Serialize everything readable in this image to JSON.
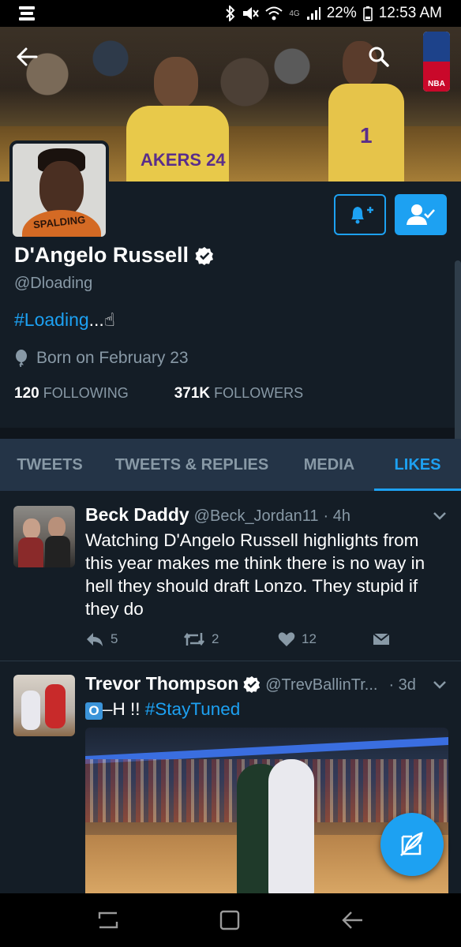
{
  "status_bar": {
    "battery_percent": "22%",
    "time": "12:53 AM",
    "network": "4G",
    "icons": [
      "espn-app-icon",
      "bluetooth-icon",
      "mute-icon",
      "wifi-icon",
      "signal-icon",
      "battery-icon"
    ]
  },
  "header": {
    "back_icon": "back-arrow-icon",
    "search_icon": "search-icon",
    "banner_jersey_left": "AKERS 24",
    "banner_jersey_right": "1",
    "nba_logo_text": "NBA"
  },
  "profile": {
    "avatar_ball_text": "SPALDING",
    "name": "D'Angelo Russell",
    "verified": true,
    "handle": "@Dloading",
    "bio_hashtag": "#Loading",
    "bio_suffix": "...☝",
    "birthday": "Born on February 23",
    "following_count": "120",
    "following_label": "FOLLOWING",
    "followers_count": "371K",
    "followers_label": "FOLLOWERS",
    "notify_button_icon": "bell-plus-icon",
    "following_button_icon": "user-check-icon"
  },
  "tabs": [
    {
      "label": "TWEETS",
      "active": false
    },
    {
      "label": "TWEETS & REPLIES",
      "active": false
    },
    {
      "label": "MEDIA",
      "active": false
    },
    {
      "label": "LIKES",
      "active": true
    }
  ],
  "tweets": [
    {
      "name": "Beck Daddy",
      "handle": "@Beck_Jordan11",
      "time": "· 4h",
      "text": "Watching D'Angelo Russell highlights from this year makes me think there is no way in hell they should draft Lonzo. They stupid if they do",
      "replies": "5",
      "retweets": "2",
      "likes": "12"
    },
    {
      "name": "Trevor Thompson",
      "verified": true,
      "handle": "@TrevBallinTr...",
      "time": "· 3d",
      "text_prefix": "O",
      "text_mid": "–H !! ",
      "hashtag": "#StayTuned"
    }
  ],
  "colors": {
    "background": "#141d26",
    "accent": "#1da1f2",
    "muted": "#8899a6",
    "tabs_bg": "#243447"
  }
}
